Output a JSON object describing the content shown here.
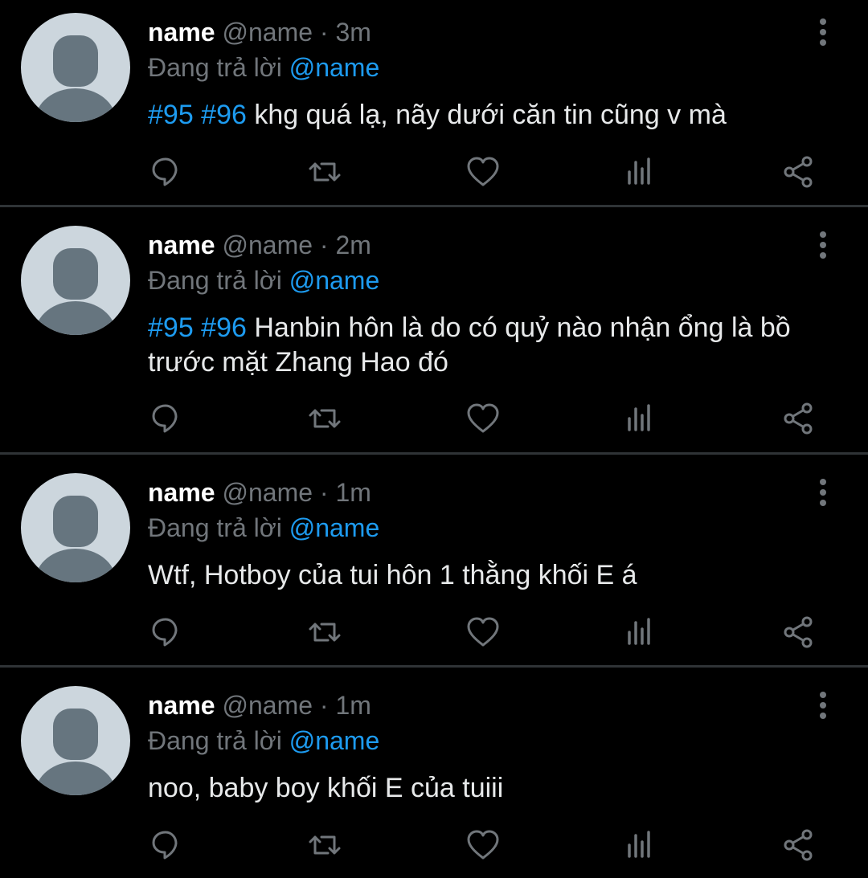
{
  "tweets": [
    {
      "display_name": "name",
      "handle": "@name",
      "dot": "·",
      "time": "3m",
      "reply_prefix": "Đang trả lời",
      "reply_to": "@name",
      "hashtags": "#95 #96",
      "text": " khg quá lạ, nãy dưới căn tin cũng v mà"
    },
    {
      "display_name": "name",
      "handle": "@name",
      "dot": "·",
      "time": "2m",
      "reply_prefix": "Đang trả lời",
      "reply_to": "@name",
      "hashtags": "#95 #96",
      "text": " Hanbin hôn là do có quỷ nào nhận ổng là bồ trước mặt Zhang Hao đó"
    },
    {
      "display_name": "name",
      "handle": "@name",
      "dot": "·",
      "time": "1m",
      "reply_prefix": "Đang trả lời",
      "reply_to": "@name",
      "hashtags": "",
      "text": "Wtf, Hotboy của tui hôn 1 thằng khối E á"
    },
    {
      "display_name": "name",
      "handle": "@name",
      "dot": "·",
      "time": "1m",
      "reply_prefix": "Đang trả lời",
      "reply_to": "@name",
      "hashtags": "",
      "text": "noo, baby boy khối E của tuiii"
    }
  ],
  "icons": {
    "reply": "reply-icon",
    "retweet": "retweet-icon",
    "like": "like-icon",
    "views": "views-icon",
    "share": "share-icon",
    "more": "more-vertical-icon"
  },
  "colors": {
    "background": "#000000",
    "accent": "#1d9bf0",
    "muted": "#71767b",
    "text": "#e7e9ea",
    "divider": "#2f3336",
    "avatar_bg": "#ccd6dd",
    "avatar_fg": "#66757f"
  }
}
